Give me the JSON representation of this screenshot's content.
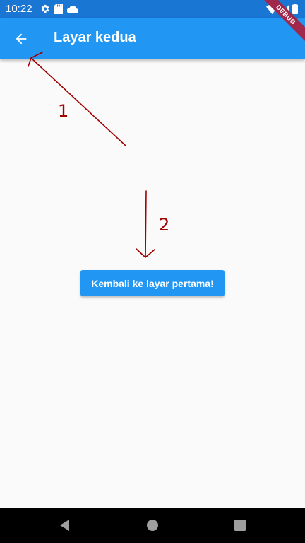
{
  "status_bar": {
    "time": "10:22",
    "left_icons": [
      "gear-icon",
      "sd-card-icon",
      "cloud-icon"
    ],
    "right_icons": [
      "wifi-icon",
      "signal-icon",
      "battery-icon"
    ]
  },
  "app_bar": {
    "title": "Layar kedua",
    "back_icon": "arrow-left-icon",
    "background": "#2196f3"
  },
  "debug_banner": {
    "label": "DEBUG"
  },
  "annotations": {
    "label_1": "1",
    "label_2": "2",
    "color": "#a00000"
  },
  "main": {
    "button_label": "Kembali ke layar pertama!"
  },
  "nav_bar": {
    "icons": [
      "back-triangle-icon",
      "home-circle-icon",
      "recents-square-icon"
    ]
  }
}
